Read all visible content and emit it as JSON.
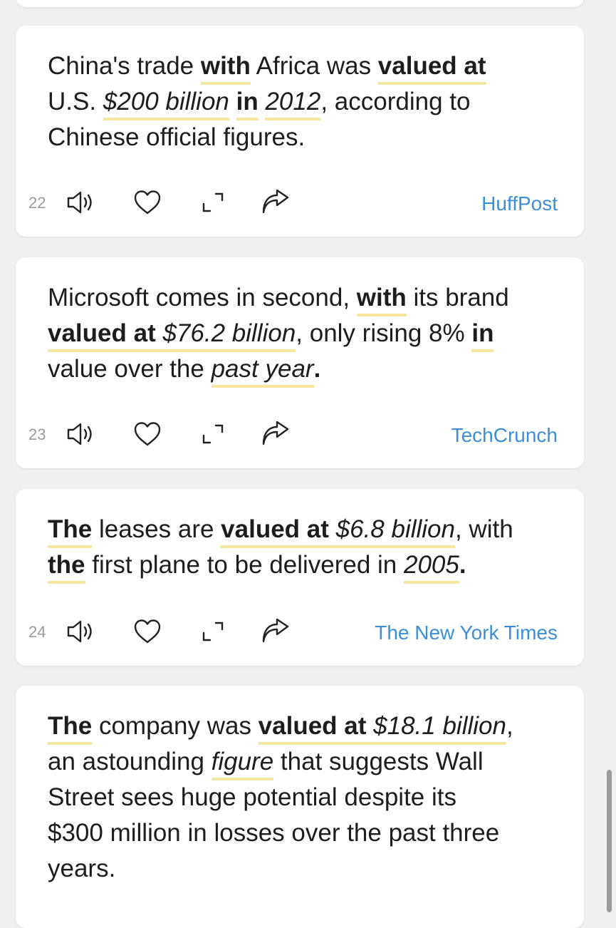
{
  "cards": [
    {
      "number": "22",
      "source": "HuffPost",
      "segments": [
        "China's trade ",
        "with",
        " Africa was ",
        "valued at",
        "U.S. ",
        "$200 billion",
        " ",
        "in",
        " ",
        "2012",
        ", according to",
        "Chinese official figures."
      ]
    },
    {
      "number": "23",
      "source": "TechCrunch",
      "segments": [
        "Microsoft comes in second, ",
        "with",
        " its brand",
        "valued at",
        " ",
        "$76.2 billion",
        ", only rising 8% ",
        "in",
        "value over the ",
        "past year",
        "."
      ]
    },
    {
      "number": "24",
      "source": "The New York Times",
      "segments": [
        "The",
        " leases are ",
        "valued at",
        " ",
        "$6.8 billion",
        ", with",
        "the",
        " first plane to be delivered in ",
        "2005",
        "."
      ]
    },
    {
      "segments": [
        "The",
        " company was ",
        "valued at",
        " ",
        "$18.1 billion",
        ",",
        "an astounding ",
        "figure",
        " that suggests Wall",
        "Street sees huge potential despite its",
        "$300 million in losses over the past three",
        "years."
      ]
    }
  ],
  "icons": {
    "speaker": "speaker-icon",
    "heart": "heart-icon",
    "expand": "expand-icon",
    "share": "share-icon"
  },
  "colors": {
    "highlight": "#f6e7a0",
    "source_link": "#3a8fd8",
    "index_number": "#9a9a9a",
    "text": "#1d1d1d"
  }
}
